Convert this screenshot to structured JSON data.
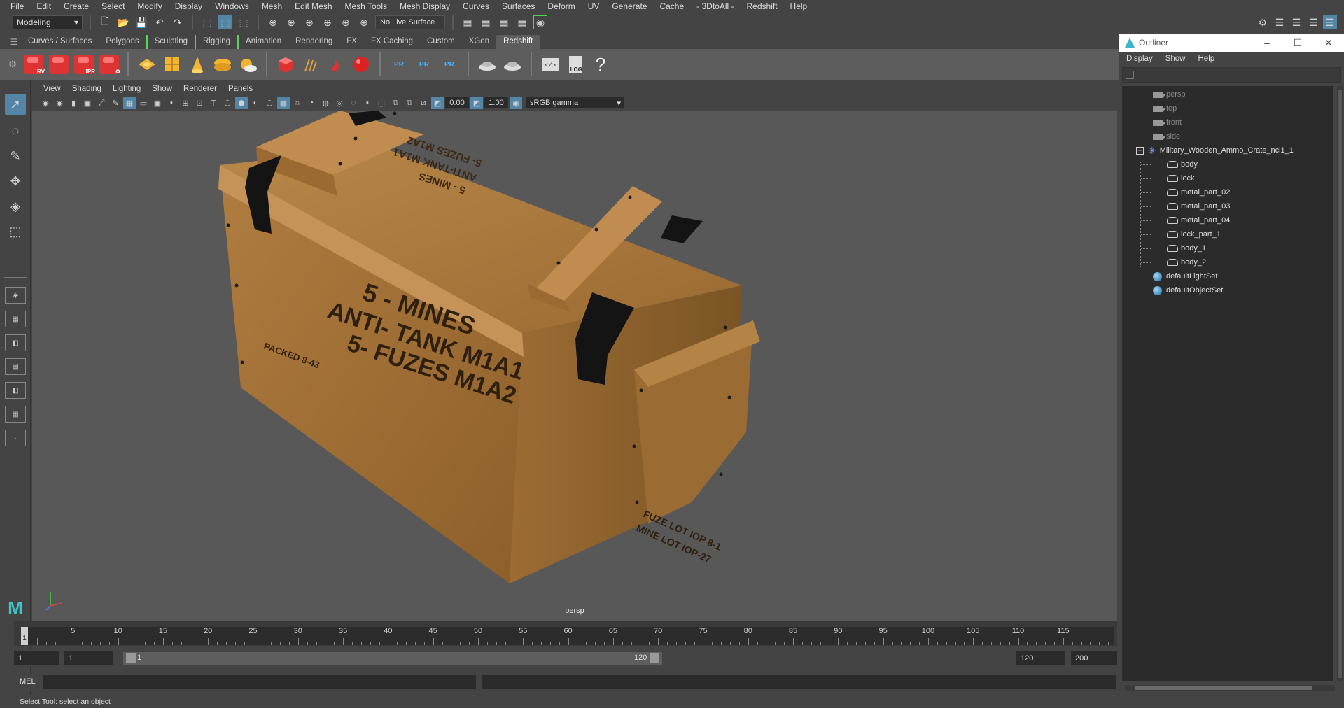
{
  "menubar": {
    "items": [
      "File",
      "Edit",
      "Create",
      "Select",
      "Modify",
      "Display",
      "Windows",
      "Mesh",
      "Edit Mesh",
      "Mesh Tools",
      "Mesh Display",
      "Curves",
      "Surfaces",
      "Deform",
      "UV",
      "Generate",
      "Cache",
      "- 3DtoAll -",
      "Redshift",
      "Help"
    ]
  },
  "statusline": {
    "mode": "Modeling",
    "live_surface": "No Live Surface"
  },
  "shelf": {
    "tabs": [
      "Curves / Surfaces",
      "Polygons",
      "Sculpting",
      "Rigging",
      "Animation",
      "Rendering",
      "FX",
      "FX Caching",
      "Custom",
      "XGen",
      "Redshift"
    ],
    "active_tab": "Redshift",
    "rs_tags": [
      "RV",
      "",
      "IPR",
      ""
    ],
    "pr_labels": [
      "PR",
      "PR",
      "PR"
    ],
    "log_label": "LOG",
    "help_label": "?"
  },
  "panel": {
    "menu": [
      "View",
      "Shading",
      "Lighting",
      "Show",
      "Renderer",
      "Panels"
    ],
    "exposure": "0.00",
    "gamma": "1.00",
    "color_space": "sRGB gamma",
    "camera_label": "persp"
  },
  "crate": {
    "stencil_top": [
      "5 - MINES",
      "ANTI-TANK M1A1",
      "5- FUZES M1A2"
    ],
    "stencil_front": [
      "5 - MINES",
      "ANTI- TANK M1A1",
      "5- FUZES M1A2"
    ],
    "stencil_side": [
      "FUZE LOT IOP 8-1",
      "MINE LOT IOP-27"
    ],
    "stencil_small": "PACKED 8-43",
    "colors": {
      "wood": "#a87a3e",
      "wood_dark": "#7b5425",
      "strap": "#141414"
    }
  },
  "timeslider": {
    "ticks": [
      "1",
      "5",
      "10",
      "15",
      "20",
      "25",
      "30",
      "35",
      "40",
      "45",
      "50",
      "55",
      "60",
      "65",
      "70",
      "75",
      "80",
      "85",
      "90",
      "95",
      "100",
      "105",
      "110",
      "115"
    ],
    "current": "1"
  },
  "rangeslider": {
    "start": "1",
    "anim_start": "1",
    "range_start": "1",
    "range_end": "120",
    "anim_end": "120",
    "end": "200"
  },
  "cmdline": {
    "label": "MEL",
    "help": "Select Tool: select an object"
  },
  "outliner": {
    "title": "Outliner",
    "menu": [
      "Display",
      "Show",
      "Help"
    ],
    "cameras": [
      "persp",
      "top",
      "front",
      "side"
    ],
    "group": "Military_Wooden_Ammo_Crate_ncl1_1",
    "children": [
      "body",
      "lock",
      "metal_part_02",
      "metal_part_03",
      "metal_part_04",
      "lock_part_1",
      "body_1",
      "body_2"
    ],
    "sets": [
      "defaultLightSet",
      "defaultObjectSet"
    ]
  }
}
